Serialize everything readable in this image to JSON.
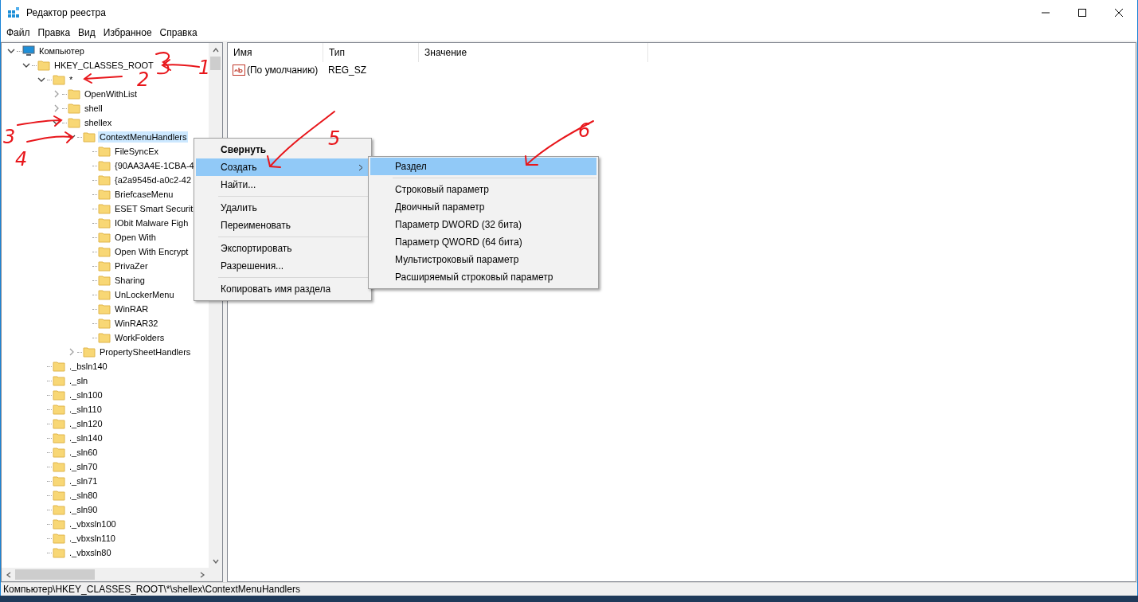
{
  "window": {
    "title": "Редактор реестра"
  },
  "menu_bar": [
    "Файл",
    "Правка",
    "Вид",
    "Избранное",
    "Справка"
  ],
  "tree": [
    {
      "label": "Компьютер",
      "expanded": true,
      "selected": false,
      "children": [
        {
          "label": "HKEY_CLASSES_ROOT",
          "expanded": true,
          "selected": false,
          "children": [
            {
              "label": "*",
              "expanded": true,
              "selected": false,
              "children": [
                {
                  "label": "OpenWithList",
                  "expanded": false,
                  "selected": false
                },
                {
                  "label": "shell",
                  "expanded": false,
                  "selected": false
                },
                {
                  "label": "shellex",
                  "expanded": true,
                  "selected": false,
                  "children": [
                    {
                      "label": "ContextMenuHandlers",
                      "expanded": true,
                      "selected": true,
                      "children": [
                        {
                          "label": "FileSyncEx",
                          "selected": false
                        },
                        {
                          "label": "{90AA3A4E-1CBA-4",
                          "selected": false
                        },
                        {
                          "label": "{a2a9545d-a0c2-42",
                          "selected": false
                        },
                        {
                          "label": "BriefcaseMenu",
                          "selected": false
                        },
                        {
                          "label": "ESET Smart Securit",
                          "selected": false
                        },
                        {
                          "label": "IObit Malware Figh",
                          "selected": false
                        },
                        {
                          "label": "Open With",
                          "selected": false
                        },
                        {
                          "label": "Open With Encrypt",
                          "selected": false
                        },
                        {
                          "label": "PrivaZer",
                          "selected": false
                        },
                        {
                          "label": "Sharing",
                          "selected": false
                        },
                        {
                          "label": "UnLockerMenu",
                          "selected": false
                        },
                        {
                          "label": "WinRAR",
                          "selected": false
                        },
                        {
                          "label": "WinRAR32",
                          "selected": false
                        },
                        {
                          "label": "WorkFolders",
                          "selected": false
                        }
                      ]
                    },
                    {
                      "label": "PropertySheetHandlers",
                      "expanded": false,
                      "selected": false
                    }
                  ]
                }
              ]
            },
            {
              "label": "._bsln140",
              "selected": false
            },
            {
              "label": "._sln",
              "selected": false
            },
            {
              "label": "._sln100",
              "selected": false
            },
            {
              "label": "._sln110",
              "selected": false
            },
            {
              "label": "._sln120",
              "selected": false
            },
            {
              "label": "._sln140",
              "selected": false
            },
            {
              "label": "._sln60",
              "selected": false
            },
            {
              "label": "._sln70",
              "selected": false
            },
            {
              "label": "._sln71",
              "selected": false
            },
            {
              "label": "._sln80",
              "selected": false
            },
            {
              "label": "._sln90",
              "selected": false
            },
            {
              "label": "._vbxsln100",
              "selected": false
            },
            {
              "label": "._vbxsln110",
              "selected": false
            },
            {
              "label": "._vbxsln80",
              "selected": false
            }
          ]
        }
      ]
    }
  ],
  "values_table": {
    "columns": [
      "Имя",
      "Тип",
      "Значение"
    ],
    "rows": [
      {
        "name": "(По умолчанию)",
        "type": "REG_SZ"
      }
    ]
  },
  "context_menu": {
    "items": [
      {
        "kind": "item",
        "label": "Свернуть",
        "default": true,
        "selected": false,
        "submenu": false
      },
      {
        "kind": "item",
        "label": "Создать",
        "default": false,
        "selected": true,
        "submenu": true
      },
      {
        "kind": "item",
        "label": "Найти...",
        "default": false,
        "selected": false,
        "submenu": false
      },
      {
        "kind": "separator"
      },
      {
        "kind": "item",
        "label": "Удалить",
        "default": false,
        "selected": false,
        "submenu": false
      },
      {
        "kind": "item",
        "label": "Переименовать",
        "default": false,
        "selected": false,
        "submenu": false
      },
      {
        "kind": "separator"
      },
      {
        "kind": "item",
        "label": "Экспортировать",
        "default": false,
        "selected": false,
        "submenu": false
      },
      {
        "kind": "item",
        "label": "Разрешения...",
        "default": false,
        "selected": false,
        "submenu": false
      },
      {
        "kind": "separator"
      },
      {
        "kind": "item",
        "label": "Копировать имя раздела",
        "default": false,
        "selected": false,
        "submenu": false
      }
    ]
  },
  "submenu": {
    "items": [
      {
        "kind": "item",
        "label": "Раздел",
        "selected": true
      },
      {
        "kind": "separator"
      },
      {
        "kind": "item",
        "label": "Строковый параметр",
        "selected": false
      },
      {
        "kind": "item",
        "label": "Двоичный параметр",
        "selected": false
      },
      {
        "kind": "item",
        "label": "Параметр DWORD (32 бита)",
        "selected": false
      },
      {
        "kind": "item",
        "label": "Параметр QWORD (64 бита)",
        "selected": false
      },
      {
        "kind": "item",
        "label": "Мультистроковый параметр",
        "selected": false
      },
      {
        "kind": "item",
        "label": "Расширяемый строковый параметр",
        "selected": false
      }
    ]
  },
  "status_bar": "Компьютер\\HKEY_CLASSES_ROOT\\*\\shellex\\ContextMenuHandlers",
  "annotations": [
    {
      "label": "1"
    },
    {
      "label": "2"
    },
    {
      "label": "3"
    },
    {
      "label": "4"
    },
    {
      "label": "5"
    },
    {
      "label": "6"
    }
  ]
}
